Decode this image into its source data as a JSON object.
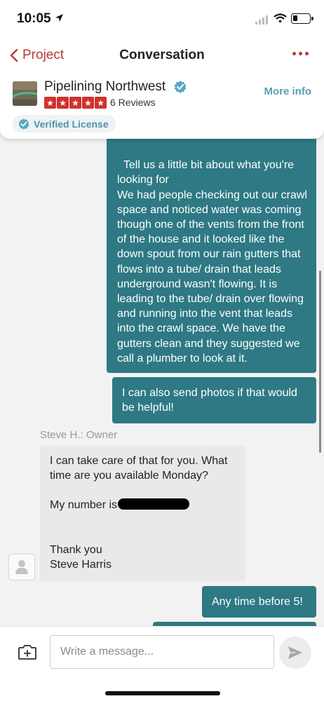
{
  "status_bar": {
    "time": "10:05",
    "location_icon": "location-arrow-icon",
    "signal_icon": "cellular-signal-icon",
    "wifi_icon": "wifi-icon",
    "battery_icon": "battery-icon"
  },
  "nav": {
    "back_icon": "chevron-left-icon",
    "back_label": "Project",
    "title": "Conversation",
    "more_icon": "ellipsis-icon"
  },
  "business": {
    "name": "Pipelining Northwest",
    "verified_icon": "verified-check-icon",
    "rating": 5,
    "reviews_label": "6 Reviews",
    "more_info_label": "More info",
    "license_label": "Verified License"
  },
  "messages": [
    {
      "direction": "outgoing",
      "text": "Tell us a little bit about what you're looking for\nWe had people checking out our crawl space and noticed water was coming though one of the vents from the front of the house and it looked like the down spout from our rain gutters that flows into a tube/ drain that leads underground wasn't flowing. It is leading to the tube/ drain over flowing and running into the vent that leads into the crawl space. We have the gutters clean and they suggested we call a plumber to look at it."
    },
    {
      "direction": "outgoing",
      "text": "I can also send photos if that would be helpful!"
    },
    {
      "direction": "incoming",
      "sender": "Steve H.: Owner",
      "line1": "I can take care of that for you. What time are you available Monday?",
      "line2": "My number is",
      "line3": "Thank you",
      "line4": "Steve Harris"
    },
    {
      "direction": "outgoing",
      "text": "Any time before 5!"
    }
  ],
  "composer": {
    "placeholder": "Write a message...",
    "camera_icon": "camera-plus-icon",
    "send_icon": "send-icon"
  },
  "colors": {
    "accent_red": "#b93a32",
    "outgoing_bubble": "#2e7983",
    "incoming_bubble": "#e9e9e9",
    "link_blue": "#5aa0b4",
    "star_red": "#d0312d"
  }
}
